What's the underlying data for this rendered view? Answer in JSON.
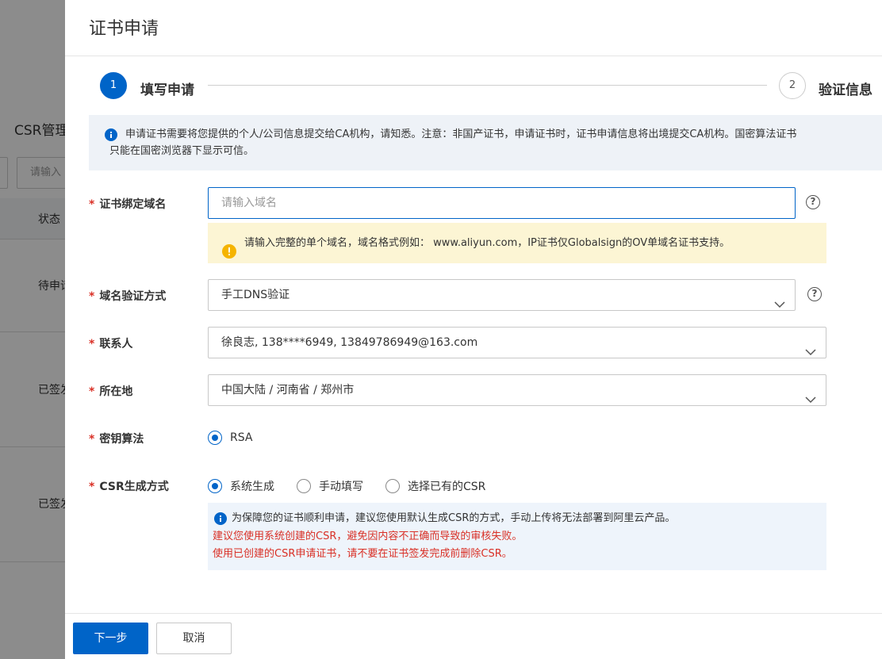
{
  "background": {
    "title": "CSR管理",
    "search_placeholder": "请输入",
    "table_header_status": "状态",
    "rows": [
      {
        "status": "待申请"
      },
      {
        "status": "已签发"
      },
      {
        "status": "已签发"
      }
    ]
  },
  "drawer": {
    "title": "证书申请",
    "steps": [
      {
        "number": "1",
        "label": "填写申请"
      },
      {
        "number": "2",
        "label": "验证信息"
      }
    ],
    "notice": {
      "line1": "申请证书需要将您提供的个人/公司信息提交给CA机构，请知悉。注意：非国产证书，申请证书时，证书申请信息将出境提交CA机构。国密算法证书",
      "line2": "只能在国密浏览器下显示可信。"
    },
    "form": {
      "domain": {
        "label": "证书绑定域名",
        "placeholder": "请输入域名",
        "warning": "请输入完整的单个域名，域名格式例如： www.aliyun.com，IP证书仅Globalsign的OV单域名证书支持。"
      },
      "verify_method": {
        "label": "域名验证方式",
        "value": "手工DNS验证"
      },
      "contact": {
        "label": "联系人",
        "value": "徐良志, 138****6949, 13849786949@163.com"
      },
      "location": {
        "label": "所在地",
        "value": "中国大陆 / 河南省 / 郑州市"
      },
      "key_algorithm": {
        "label": "密钥算法",
        "options": [
          "RSA"
        ],
        "selected": "RSA"
      },
      "csr_method": {
        "label": "CSR生成方式",
        "options": [
          "系统生成",
          "手动填写",
          "选择已有的CSR"
        ],
        "selected": "系统生成",
        "info": "为保障您的证书顺利申请，建议您使用默认生成CSR的方式，手动上传将无法部署到阿里云产品。",
        "warn1": "建议您使用系统创建的CSR，避免因内容不正确而导致的审核失败。",
        "warn2": "使用已创建的CSR申请证书，请不要在证书签发完成前删除CSR。"
      }
    },
    "footer": {
      "next_label": "下一步",
      "cancel_label": "取消"
    }
  },
  "colors": {
    "primary": "#0064c8",
    "required": "#d93026",
    "warning_bg": "#fcf5d4",
    "info_bg": "#eef4fb"
  }
}
